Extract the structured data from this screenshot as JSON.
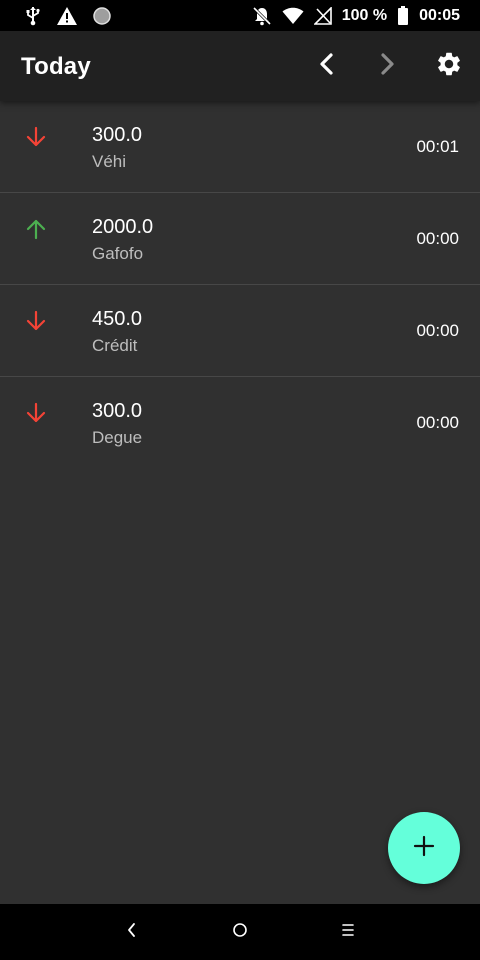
{
  "status_bar": {
    "battery_text": "100 %",
    "time": "00:05",
    "icons": [
      "usb-icon",
      "warning-icon",
      "circle-icon",
      "notifications-off-icon",
      "wifi-icon",
      "no-signal-icon",
      "battery-icon"
    ]
  },
  "app_bar": {
    "title": "Today",
    "prev_icon": "chevron-left-icon",
    "next_icon": "chevron-right-icon",
    "settings_icon": "gear-icon"
  },
  "colors": {
    "background": "#303030",
    "app_bar": "#212121",
    "expense": "#f44336",
    "income": "#4caf50",
    "fab": "#64ffda",
    "divider": "#474747"
  },
  "transactions": [
    {
      "direction": "down",
      "amount": "300.0",
      "label": "Véhi",
      "time": "00:01"
    },
    {
      "direction": "up",
      "amount": "2000.0",
      "label": "Gafofo",
      "time": "00:00"
    },
    {
      "direction": "down",
      "amount": "450.0",
      "label": "Crédit",
      "time": "00:00"
    },
    {
      "direction": "down",
      "amount": "300.0",
      "label": "Degue",
      "time": "00:00"
    }
  ],
  "fab": {
    "icon": "plus-icon"
  },
  "nav_bar": {
    "icons": [
      "back-icon",
      "home-icon",
      "recents-icon"
    ]
  }
}
